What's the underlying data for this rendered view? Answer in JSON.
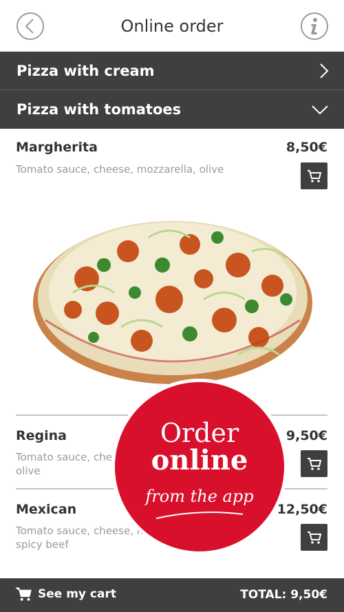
{
  "header": {
    "title": "Online order",
    "back_icon": "back-arrow-icon",
    "info_icon": "info-icon"
  },
  "categories": [
    {
      "label": "Pizza with cream",
      "state": "collapsed",
      "icon": "chevron-right-icon"
    },
    {
      "label": "Pizza with tomatoes",
      "state": "expanded",
      "icon": "chevron-down-icon"
    }
  ],
  "items": [
    {
      "name": "Margherita",
      "price": "8,50€",
      "description": "Tomato sauce, cheese, mozzarella, olive"
    },
    {
      "name": "Regina",
      "price": "9,50€",
      "description_line1": "Tomato sauce, cheese",
      "description_line2": "olive"
    },
    {
      "name": "Mexican",
      "price": "12,50€",
      "description_line1": "Tomato sauce, cheese, moz",
      "description_line2": "spicy beef"
    }
  ],
  "badge": {
    "line1": "Order",
    "line2": "online",
    "line3": "from the app"
  },
  "footer": {
    "cart_label": "See my cart",
    "total": "TOTAL: 9,50€"
  },
  "colors": {
    "bar": "#3f3f3f",
    "accent": "#d8102c"
  }
}
